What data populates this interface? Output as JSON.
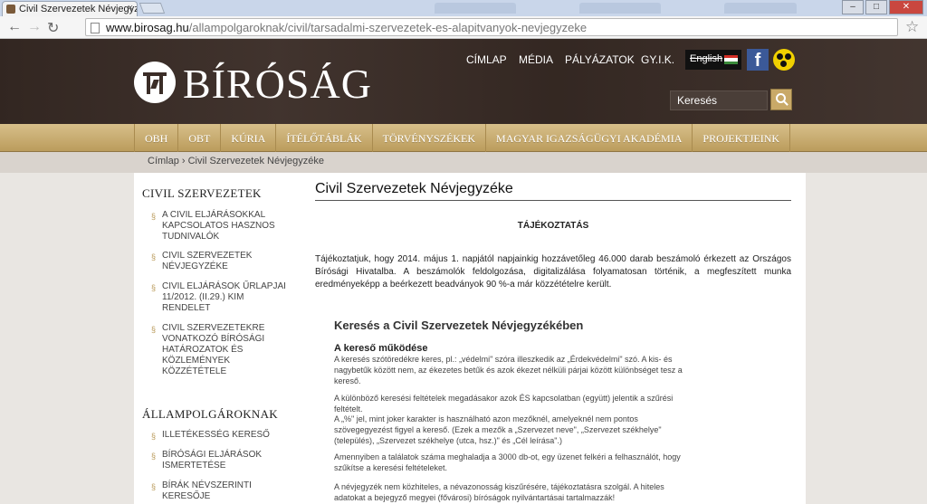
{
  "browser": {
    "tab_title": "Civil Szervezetek Névjegyzé",
    "url_host": "www.birosag.hu",
    "url_path": "/allampolgaroknak/civil/tarsadalmi-szervezetek-es-alapitvanyok-nevjegyzeke"
  },
  "header": {
    "logo_text": "BÍRÓSÁG",
    "top_nav": [
      "CÍMLAP",
      "MÉDIA",
      "PÁLYÁZATOK",
      "GY.I.K."
    ],
    "language": "English",
    "search_placeholder": "Keresés"
  },
  "main_nav": [
    "OBH",
    "OBT",
    "KÚRIA",
    "ÍTÉLŐTÁBLÁK",
    "TÖRVÉNYSZÉKEK",
    "MAGYAR IGAZSÁGÜGYI AKADÉMIA",
    "PROJEKTJEINK"
  ],
  "breadcrumb": "Címlap › Civil Szervezetek Névjegyzéke",
  "sidebar": {
    "section1_title": "CIVIL SZERVEZETEK",
    "section1_items": [
      "A CIVIL ELJÁRÁSOKKAL KAPCSOLATOS HASZNOS TUDNIVALÓK",
      "CIVIL SZERVEZETEK NÉVJEGYZÉKE",
      "CIVIL ELJÁRÁSOK ŰRLAPJAI 11/2012. (II.29.) KIM RENDELET",
      "CIVIL SZERVEZETEKRE VONATKOZÓ BÍRÓSÁGI HATÁROZATOK ÉS KÖZLEMÉNYEK KÖZZÉTÉTELE"
    ],
    "section2_title": "ÁLLAMPOLGÁROKNAK",
    "section2_items": [
      "ILLETÉKESSÉG KERESŐ",
      "BÍRÓSÁGI ELJÁRÁSOK ISMERTETÉSE",
      "BÍRÁK NÉVSZERINTI KERESŐJE"
    ]
  },
  "content": {
    "title": "Civil Szervezetek Névjegyzéke",
    "subtitle": "TÁJÉKOZTATÁS",
    "intro": "Tájékoztatjuk, hogy 2014. május 1. napjától napjainkig hozzávetőleg 46.000 darab beszámoló érkezett az Országos Bírósági Hivatalba. A beszámolók feldolgozása, digitalizálása folyamatosan történik, a megfeszített munka eredményeképp a beérkezett beadványok 90 %-a már közzétételre került.",
    "search_heading": "Keresés a Civil Szervezetek Névjegyzékében",
    "how_heading": "A kereső működése",
    "paragraphs": [
      "A keresés szótöredékre keres, pl.: „védelmi\" szóra illeszkedik az „Érdekvédelmi\" szó. A kis- és nagybetűk között nem, az ékezetes betűk és azok ékezet nélküli párjai között különbséget tesz a kereső.",
      "A különböző keresési feltételek megadásakor azok ÉS kapcsolatban (együtt) jelentik a szűrési feltételt.",
      "A „%\" jel, mint joker karakter is használható azon mezőknél, amelyeknél nem pontos szövegegyezést figyel a kereső. (Ezek a mezők a „Szervezet neve\", „Szervezet székhelye\" (település), „Szervezet székhelye (utca, hsz.)\" és „Cél leírása\".)",
      "Amennyiben a találatok száma meghaladja a 3000 db-ot, egy üzenet felkéri a felhasználót, hogy szűkítse a keresési feltételeket.",
      "A névjegyzék nem közhiteles, a névazonosság kiszűrésére, tájékoztatásra szolgál. A hiteles adatokat a bejegyző megyei (fővárosi) bíróságok nyilvántartásai tartalmazzák!"
    ]
  },
  "colors": {
    "header_bg": "#3b2d27",
    "nav_gold": "#c9a968",
    "facebook": "#3b5998"
  }
}
